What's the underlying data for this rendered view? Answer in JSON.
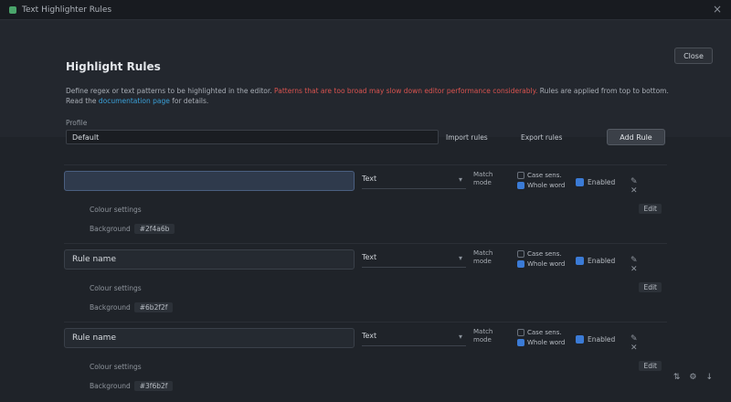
{
  "titlebar": {
    "tab_label": "Text Highlighter Rules",
    "close_glyph": "×"
  },
  "panel": {
    "close_button": "Close",
    "title": "Highlight Rules",
    "description_prefix": "Define regex or text patterns to be highlighted in the editor. ",
    "description_warning": "Patterns that are too broad may slow down editor performance considerably.",
    "description_middle": " Rules are applied from top to bottom. Read the ",
    "description_link": "documentation page",
    "description_suffix": " for details.",
    "profile_label": "Profile",
    "profile_value": "Default",
    "import_label": "Import rules",
    "export_label": "Export rules",
    "add_rule_label": "Add Rule"
  },
  "rules": [
    {
      "name": "",
      "type": "Text",
      "mode_label": "Match mode",
      "opt1": "Case sens.",
      "opt2": "Whole word",
      "opt2_on": true,
      "enable_label": "Enabled",
      "icons": "✎ ✕",
      "sub1": "Colour settings",
      "sub2_label": "Background",
      "sub2_pill": "#2f4a6b",
      "sub_right": "Edit"
    },
    {
      "name": "Rule name",
      "type": "Text",
      "mode_label": "Match mode",
      "opt1": "Case sens.",
      "opt2": "Whole word",
      "opt2_on": true,
      "enable_label": "Enabled",
      "icons": "✎ ✕",
      "sub1": "Colour settings",
      "sub2_label": "Background",
      "sub2_pill": "#6b2f2f",
      "sub_right": "Edit"
    },
    {
      "name": "Rule name",
      "type": "Text",
      "mode_label": "Match mode",
      "opt1": "Case sens.",
      "opt2": "Whole word",
      "opt2_on": true,
      "enable_label": "Enabled",
      "icons": "✎ ✕",
      "sub1": "Colour settings",
      "sub2_label": "Background",
      "sub2_pill": "#3f6b2f",
      "sub_right": "Edit"
    }
  ],
  "bottom": {
    "icon1": "⇅",
    "icon2": "⚙",
    "icon3": "↓"
  }
}
